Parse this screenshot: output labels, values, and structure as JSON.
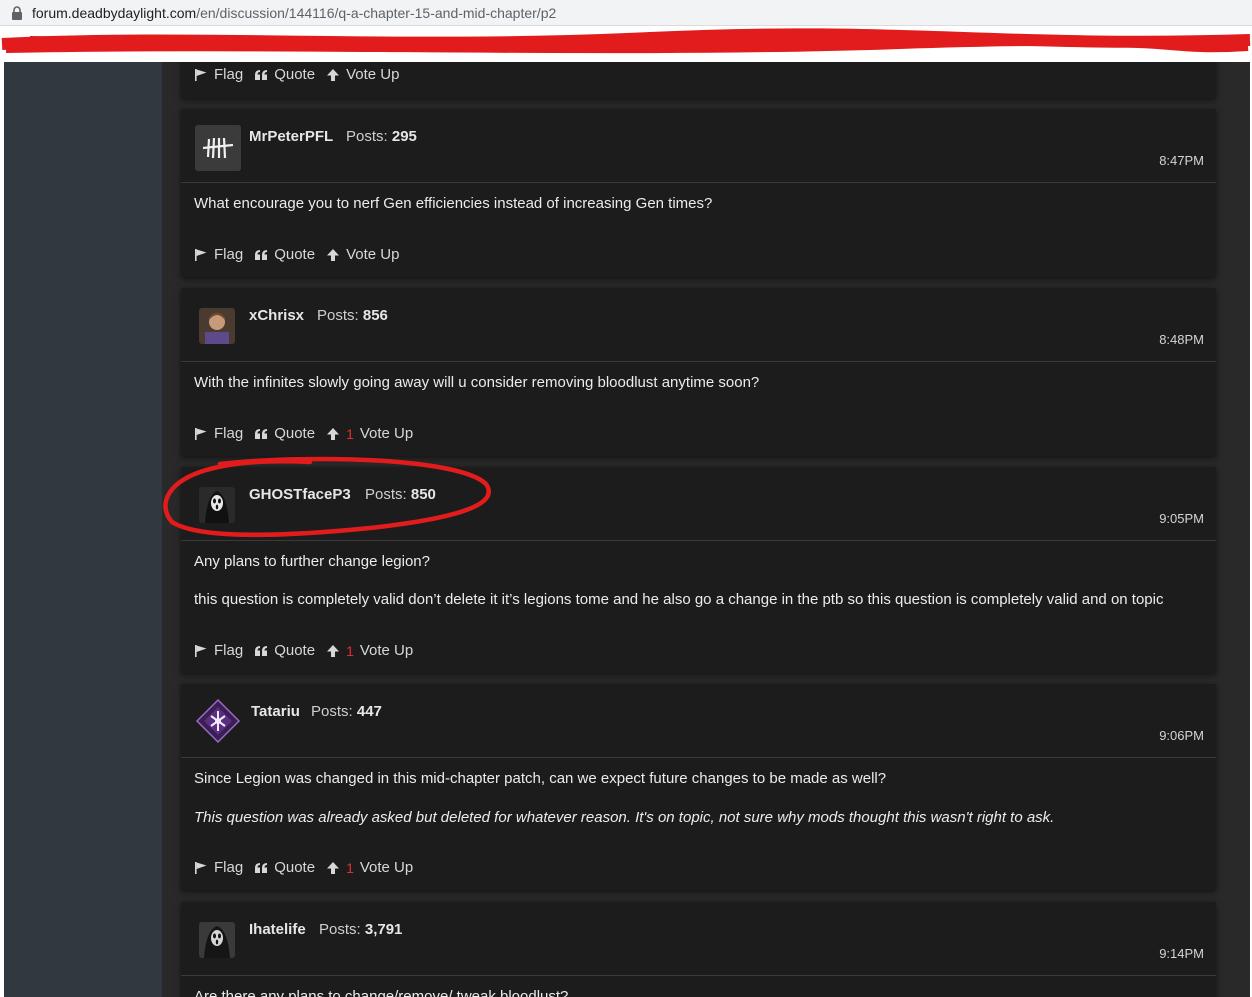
{
  "browser": {
    "url_host": "forum.deadbydaylight.com",
    "url_path": "/en/discussion/144116/q-a-chapter-15-and-mid-chapter/p2"
  },
  "actions": {
    "flag": "Flag",
    "quote": "Quote",
    "vote_up": "Vote Up"
  },
  "posts_label": "Posts:",
  "annotation_color": "#e21c1c",
  "posts": [
    {
      "user": "MrPeterPFL",
      "post_count": "295",
      "time": "8:47PM",
      "paragraphs": [
        "What encourage you to nerf Gen efficiencies instead of increasing Gen times?"
      ],
      "votes": ""
    },
    {
      "user": "xChrisx",
      "post_count": "856",
      "time": "8:48PM",
      "paragraphs": [
        "With the infinites slowly going away will u consider removing bloodlust anytime soon?"
      ],
      "votes": "1"
    },
    {
      "user": "GHOSTfaceP3",
      "post_count": "850",
      "time": "9:05PM",
      "paragraphs": [
        "Any plans to further change legion?",
        "this question is completely valid don’t delete it it’s legions tome and he also go a change in the ptb so this question is completely valid and on topic"
      ],
      "votes": "1"
    },
    {
      "user": "Tatariu",
      "post_count": "447",
      "time": "9:06PM",
      "paragraphs": [
        "Since Legion was changed in this mid-chapter patch, can we expect future changes to be made as well?",
        "This question was already asked but deleted for whatever reason. It's on topic, not sure why mods thought this wasn't right to ask."
      ],
      "votes": "1"
    },
    {
      "user": "Ihatelife",
      "post_count": "3,791",
      "time": "9:14PM",
      "paragraphs": [
        "Are there any plans to change/remove/ tweak bloodlust?"
      ],
      "votes": ""
    }
  ]
}
